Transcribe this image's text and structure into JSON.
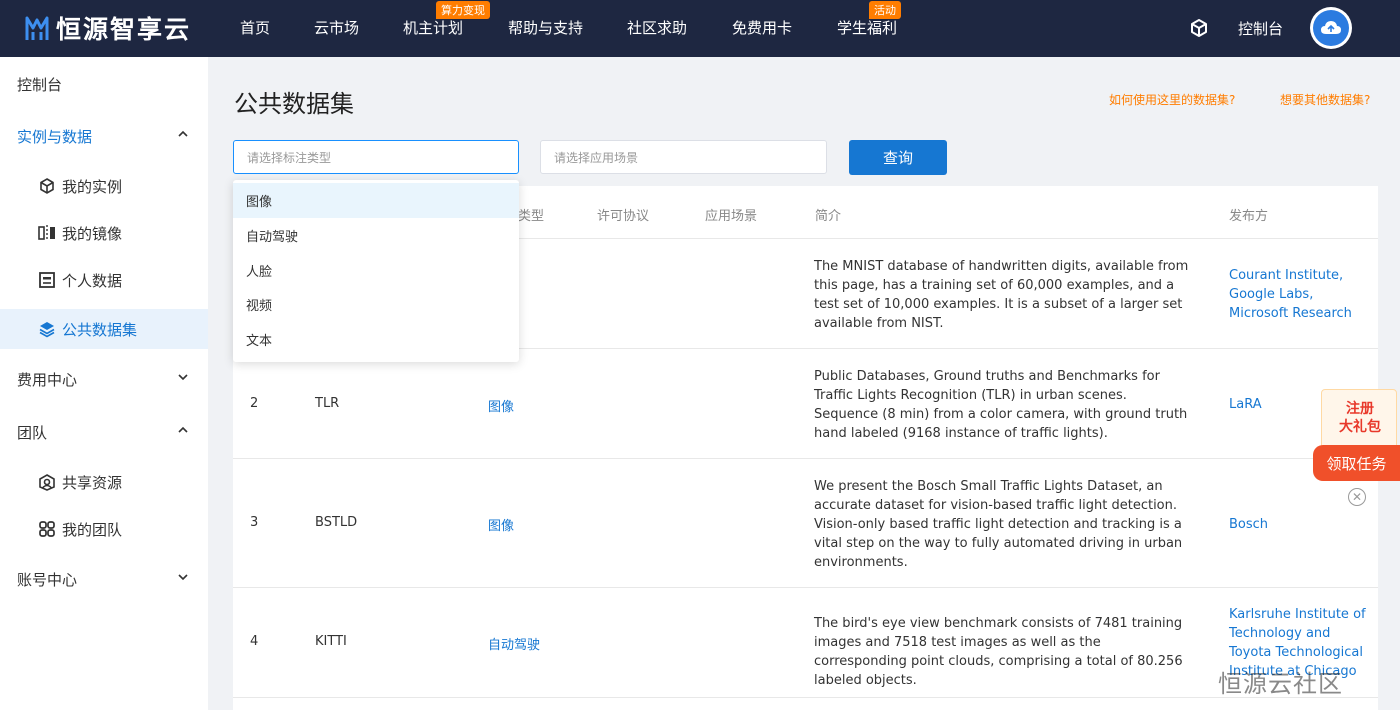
{
  "brand": {
    "name": "恒源智享云"
  },
  "topnav": {
    "items": [
      "首页",
      "云市场",
      "机主计划",
      "帮助与支持",
      "社区求助",
      "免费用卡",
      "学生福利"
    ],
    "badges": {
      "host_plan": "算力变现",
      "student": "活动"
    },
    "console": "控制台"
  },
  "sidebar": {
    "console": "控制台",
    "instances_data": "实例与数据",
    "my_instances": "我的实例",
    "my_images": "我的镜像",
    "personal_data": "个人数据",
    "public_datasets": "公共数据集",
    "billing": "费用中心",
    "team": "团队",
    "shared_resources": "共享资源",
    "my_team": "我的团队",
    "account": "账号中心"
  },
  "main": {
    "title": "公共数据集",
    "help_link_1": "如何使用这里的数据集?",
    "help_link_2": "想要其他数据集?",
    "label_type_placeholder": "请选择标注类型",
    "scenario_placeholder": "请选择应用场景",
    "query_button": "查询"
  },
  "dropdown": {
    "options": [
      "图像",
      "自动驾驶",
      "人脸",
      "视频",
      "文本"
    ]
  },
  "table": {
    "headers": {
      "type": "类型",
      "license": "许可协议",
      "scenario": "应用场景",
      "intro": "简介",
      "publisher": "发布方"
    },
    "rows": [
      {
        "desc": "The MNIST database of handwritten digits, available from this page, has a training set of 60,000 examples, and a test set of 10,000 examples. It is a subset of a larger set available from NIST.",
        "publisher": "Courant Institute, Google Labs, Microsoft Research"
      },
      {
        "index": "2",
        "name": "TLR",
        "type": "图像",
        "desc": "Public Databases, Ground truths and Benchmarks for Traffic Lights Recognition (TLR) in urban scenes. Sequence (8 min) from a color camera, with ground truth hand labeled (9168 instance of traffic lights).",
        "publisher": "LaRA"
      },
      {
        "index": "3",
        "name": "BSTLD",
        "type": "图像",
        "desc": "We present the Bosch Small Traffic Lights Dataset, an accurate dataset for vision-based traffic light detection. Vision-only based traffic light detection and tracking is a vital step on the way to fully automated driving in urban environments.",
        "publisher": "Bosch"
      },
      {
        "index": "4",
        "name": "KITTI",
        "type": "自动驾驶",
        "desc": "The bird's eye view benchmark consists of 7481 training images and 7518 test images as well as the corresponding point clouds, comprising a total of 80.256 labeled objects.",
        "publisher": "Karlsruhe Institute of Technology and Toyota Technological Institute at Chicago"
      }
    ]
  },
  "promo": {
    "line1": "注册",
    "line2": "大礼包",
    "cta": "领取任务"
  },
  "watermark": "恒源云社区"
}
